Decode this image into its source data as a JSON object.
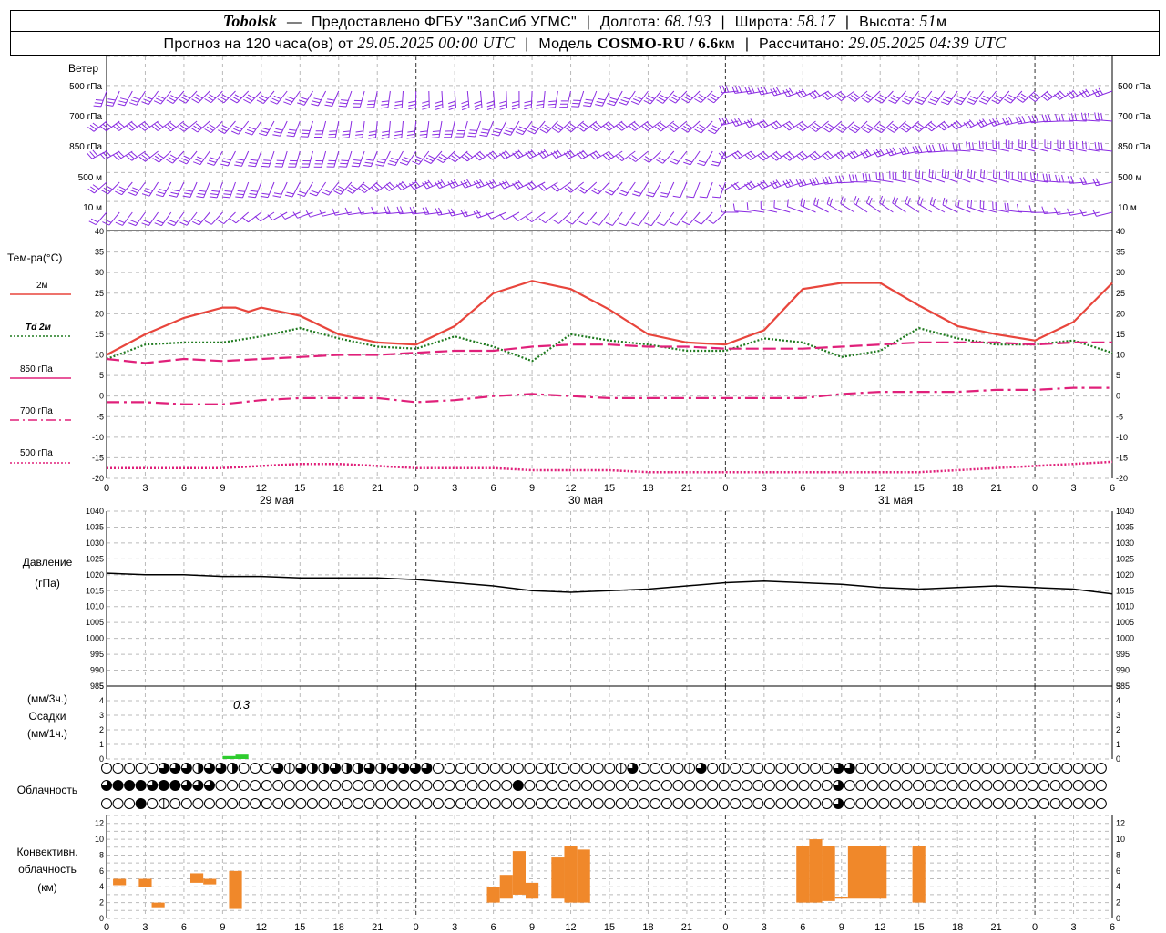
{
  "header": {
    "station": "Tobolsk",
    "dash": "—",
    "provider": "Предоставлено ФГБУ \"ЗапСиб УГМС\"",
    "lon_label": "Долгота:",
    "lon_value": "68.193",
    "lat_label": "Широта:",
    "lat_value": "58.17",
    "alt_label": "Высота:",
    "alt_value": "51",
    "alt_unit": "м",
    "forecast_label": "Прогноз на 120 часа(ов) от",
    "forecast_from": "29.05.2025 00:00 UTC",
    "model_label": "Модель",
    "model_name": "COSMO-RU / 6.6",
    "model_unit": "км",
    "calc_label": "Рассчитано:",
    "calc_time": "29.05.2025 04:39 UTC"
  },
  "wind_panel": {
    "title": "Ветер",
    "levels": [
      "500 гПа",
      "700 гПа",
      "850 гПа",
      "500 м",
      "10 м"
    ],
    "right_levels": [
      "500 гПа",
      "700 гПа",
      "850 гПа",
      "500 м",
      "10 м"
    ],
    "barb_color": "#8a2be2"
  },
  "temp_panel": {
    "title": "Тем-ра(°С)",
    "legend": [
      {
        "label": "2м",
        "color": "#e8453c",
        "dash": "solid"
      },
      {
        "label": "Td 2м",
        "color": "#1f7a1f",
        "dash": "dot"
      },
      {
        "label": "850 гПа",
        "color": "#e0207a",
        "dash": "longdash"
      },
      {
        "label": "700 гПа",
        "color": "#e0207a",
        "dash": "dashdot"
      },
      {
        "label": "500 гПа",
        "color": "#e0207a",
        "dash": "fine"
      }
    ]
  },
  "time_axis": {
    "hour_ticks": [
      "0",
      "3",
      "6",
      "9",
      "12",
      "15",
      "18",
      "21",
      "0",
      "3",
      "6",
      "9",
      "12",
      "15",
      "18",
      "21",
      "0",
      "3",
      "6",
      "9",
      "12",
      "15",
      "18",
      "21",
      "0",
      "3",
      "6"
    ],
    "days": [
      "29 мая",
      "30 мая",
      "31 мая"
    ]
  },
  "pressure_panel": {
    "title": "Давление",
    "unit": "(гПа)",
    "yticks": [
      "1040",
      "1035",
      "1030",
      "1025",
      "1020",
      "1015",
      "1010",
      "1005",
      "1000",
      "995",
      "990",
      "985"
    ]
  },
  "precip_panel": {
    "unit_top": "(мм/3ч.)",
    "title": "Осадки",
    "unit_bottom": "(мм/1ч.)",
    "annotation": "0.3",
    "yticks": [
      "5",
      "4",
      "3",
      "2",
      "1",
      "0"
    ],
    "color": "#2ecc2e"
  },
  "cloud_panel": {
    "title": "Облачность",
    "rows": [
      "0000033323320003132232232333300000000001000001300001301000000000330000000000000000000000",
      "3444344333000000000000000000000000004000000000000000000000000000300000000000000000000000",
      "0004010000000000000000000000000000000000000000000000000000000000300000000000000000000000"
    ]
  },
  "conv_panel": {
    "title_1": "Конвективн.",
    "title_2": "облачность",
    "unit": "(км)",
    "yticks": [
      "12",
      "10",
      "8",
      "6",
      "4",
      "2",
      "0"
    ],
    "color": "#f0882a"
  },
  "chart_data": [
    {
      "type": "line",
      "title": "Тем-ра(°С)",
      "x_unit": "hours since 29.05.2025 00:00 UTC",
      "ylim": [
        -20,
        40
      ],
      "yticks": [
        -20,
        -15,
        -10,
        -5,
        0,
        5,
        10,
        15,
        20,
        25,
        30,
        35,
        40
      ],
      "grid": true,
      "series": [
        {
          "name": "2м",
          "x": [
            0,
            3,
            6,
            9,
            10,
            11,
            12,
            15,
            18,
            21,
            24,
            27,
            30,
            33,
            36,
            39,
            42,
            45,
            48,
            51,
            54,
            57,
            60,
            63,
            66,
            69,
            72,
            75,
            78
          ],
          "values": [
            10,
            15,
            19,
            21.5,
            21.5,
            20.5,
            21.5,
            19.5,
            15,
            13,
            12.5,
            17,
            25,
            28,
            26,
            21,
            15,
            13,
            12.5,
            16,
            26,
            27.5,
            27.5,
            22,
            17,
            15,
            13.5,
            18,
            27.5
          ]
        },
        {
          "name": "Td 2м",
          "x": [
            0,
            3,
            6,
            9,
            12,
            15,
            18,
            21,
            24,
            27,
            30,
            33,
            36,
            39,
            42,
            45,
            48,
            51,
            54,
            57,
            60,
            63,
            66,
            69,
            72,
            75,
            78
          ],
          "values": [
            9,
            12.5,
            13,
            13,
            14.5,
            16.5,
            14,
            12,
            11.5,
            14.5,
            12,
            8.5,
            15,
            13.5,
            12.5,
            11,
            11,
            14,
            13,
            9.5,
            11,
            16.5,
            14,
            12.5,
            12.5,
            13.5,
            10.5
          ]
        },
        {
          "name": "850 гПа",
          "x": [
            0,
            3,
            6,
            9,
            12,
            15,
            18,
            21,
            24,
            27,
            30,
            33,
            36,
            39,
            42,
            45,
            48,
            51,
            54,
            57,
            60,
            63,
            66,
            69,
            72,
            75,
            78
          ],
          "values": [
            9,
            8,
            9,
            8.5,
            9,
            9.5,
            10,
            10,
            10.5,
            11,
            11,
            12,
            12.5,
            12.5,
            12,
            12,
            11.5,
            11.5,
            11.5,
            12,
            12.5,
            13,
            13,
            13,
            12.5,
            13,
            13
          ]
        },
        {
          "name": "700 гПа",
          "x": [
            0,
            3,
            6,
            9,
            12,
            15,
            18,
            21,
            24,
            27,
            30,
            33,
            36,
            39,
            42,
            45,
            48,
            51,
            54,
            57,
            60,
            63,
            66,
            69,
            72,
            75,
            78
          ],
          "values": [
            -1.5,
            -1.5,
            -2,
            -2,
            -1,
            -0.5,
            -0.5,
            -0.5,
            -1.5,
            -1,
            0,
            0.5,
            0,
            -0.5,
            -0.5,
            -0.5,
            -0.5,
            -0.5,
            -0.5,
            0.5,
            1,
            1,
            1,
            1.5,
            1.5,
            2,
            2
          ]
        },
        {
          "name": "500 гПа",
          "x": [
            0,
            3,
            6,
            9,
            12,
            15,
            18,
            21,
            24,
            27,
            30,
            33,
            36,
            39,
            42,
            45,
            48,
            51,
            54,
            57,
            60,
            63,
            66,
            69,
            72,
            75,
            78
          ],
          "values": [
            -17.5,
            -17.5,
            -17.5,
            -17.5,
            -17,
            -16.5,
            -16.5,
            -17,
            -17.5,
            -17.5,
            -17.5,
            -18,
            -18,
            -18,
            -18.5,
            -18.5,
            -18.5,
            -18.5,
            -18.5,
            -18.5,
            -18.5,
            -18.5,
            -18,
            -17.5,
            -17,
            -16.5,
            -16
          ]
        }
      ]
    },
    {
      "type": "line",
      "title": "Давление",
      "ylim": [
        985,
        1040
      ],
      "grid": true,
      "series": [
        {
          "name": "Давление",
          "x": [
            0,
            3,
            6,
            9,
            12,
            15,
            18,
            21,
            24,
            27,
            30,
            33,
            36,
            39,
            42,
            45,
            48,
            51,
            54,
            57,
            60,
            63,
            66,
            69,
            72,
            75,
            78
          ],
          "values": [
            1020.5,
            1020,
            1020,
            1019.5,
            1019.5,
            1019,
            1019,
            1019,
            1018.5,
            1017.5,
            1016.5,
            1015,
            1014.5,
            1015,
            1015.5,
            1016.5,
            1017.5,
            1018,
            1017.5,
            1017,
            1016,
            1015.5,
            1016,
            1016.5,
            1016,
            1015.5,
            1014
          ]
        }
      ]
    },
    {
      "type": "bar",
      "title": "Осадки",
      "ylim": [
        0,
        5
      ],
      "bars": [
        {
          "x0": 9,
          "x1": 10,
          "value": 0.2
        },
        {
          "x0": 10,
          "x1": 11,
          "value": 0.3
        }
      ]
    },
    {
      "type": "bar",
      "title": "Конвективн. облачность (км)",
      "ylim": [
        0,
        13
      ],
      "bars": [
        {
          "x0": 0.5,
          "x1": 1.5,
          "base": 4.2,
          "top": 5
        },
        {
          "x0": 2.5,
          "x1": 3.5,
          "base": 4,
          "top": 5
        },
        {
          "x0": 3.5,
          "x1": 4.5,
          "base": 1.3,
          "top": 2
        },
        {
          "x0": 6.5,
          "x1": 7.5,
          "base": 4.5,
          "top": 5.7
        },
        {
          "x0": 7.5,
          "x1": 8.5,
          "base": 4.3,
          "top": 5
        },
        {
          "x0": 9.5,
          "x1": 10.5,
          "base": 1.2,
          "top": 6
        },
        {
          "x0": 29.5,
          "x1": 30.5,
          "base": 2,
          "top": 4
        },
        {
          "x0": 30.5,
          "x1": 31.5,
          "base": 2.5,
          "top": 5.5
        },
        {
          "x0": 31.5,
          "x1": 32.5,
          "base": 3,
          "top": 8.5
        },
        {
          "x0": 32.5,
          "x1": 33.5,
          "base": 2.5,
          "top": 4.5
        },
        {
          "x0": 34.5,
          "x1": 35.5,
          "base": 2.5,
          "top": 7.7
        },
        {
          "x0": 35.5,
          "x1": 36.5,
          "base": 2,
          "top": 9.2
        },
        {
          "x0": 36.5,
          "x1": 37.5,
          "base": 2,
          "top": 8.7
        },
        {
          "x0": 53.5,
          "x1": 54.5,
          "base": 2,
          "top": 9.2
        },
        {
          "x0": 54.5,
          "x1": 55.5,
          "base": 2,
          "top": 10
        },
        {
          "x0": 55.5,
          "x1": 56.5,
          "base": 2.2,
          "top": 9.2
        },
        {
          "x0": 56.5,
          "x1": 57.5,
          "base": 2.5,
          "top": 2.7
        },
        {
          "x0": 57.5,
          "x1": 58.5,
          "base": 2.5,
          "top": 9.2
        },
        {
          "x0": 58.5,
          "x1": 59.5,
          "base": 2.5,
          "top": 9.2
        },
        {
          "x0": 59.5,
          "x1": 60.5,
          "base": 2.5,
          "top": 9.2
        },
        {
          "x0": 62.5,
          "x1": 63.5,
          "base": 2,
          "top": 9.2
        }
      ]
    }
  ]
}
